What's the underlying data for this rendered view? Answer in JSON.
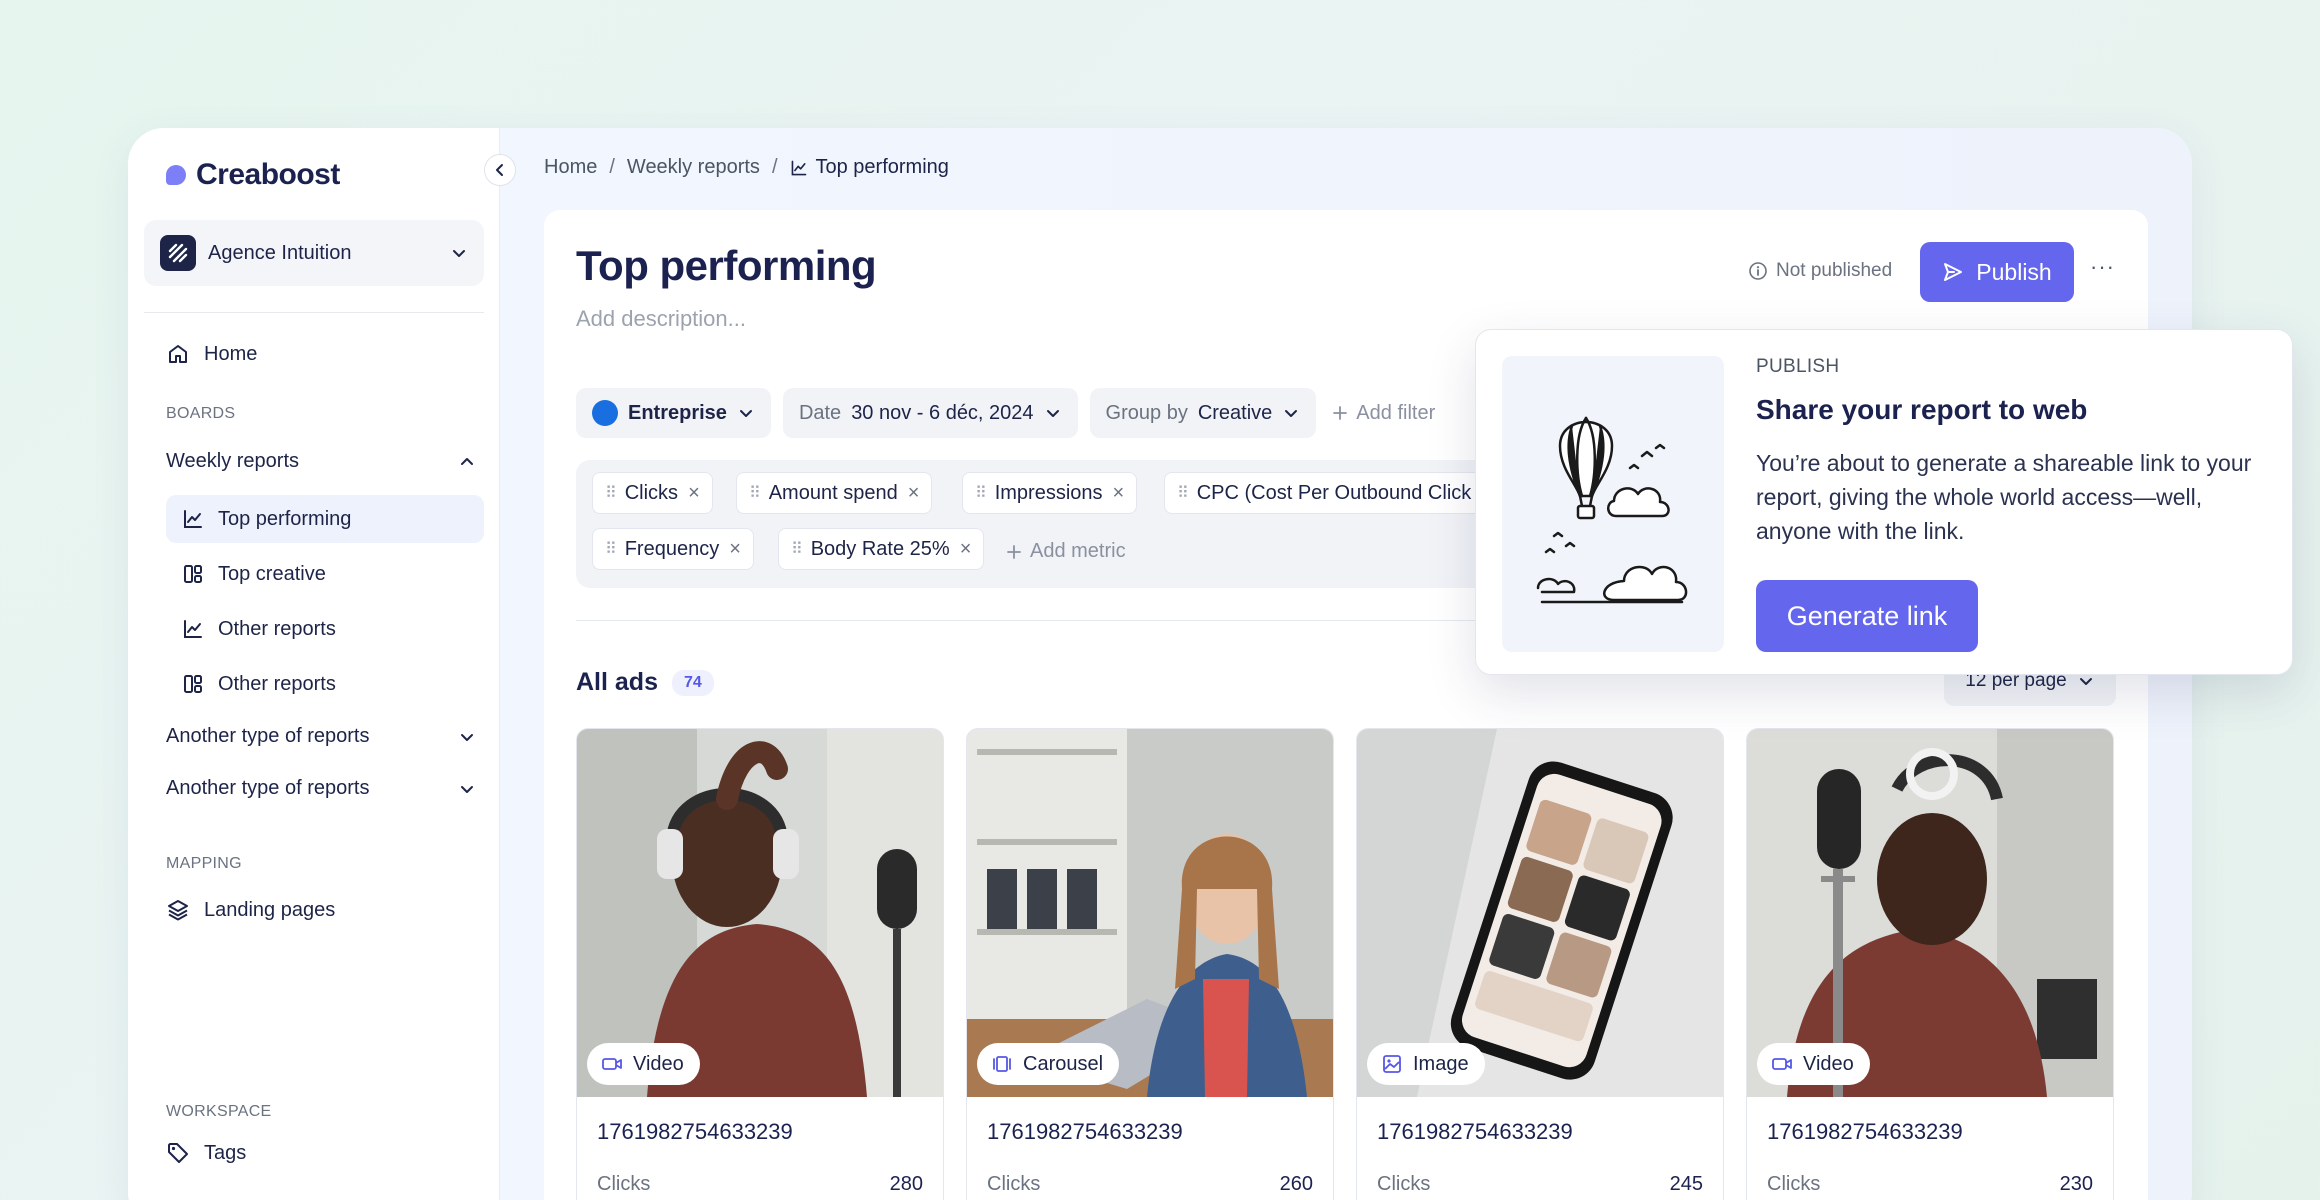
{
  "app": {
    "name": "Creaboost"
  },
  "workspace": {
    "name": "Agence Intuition"
  },
  "sidebar": {
    "home": "Home",
    "boards_label": "BOARDS",
    "weekly_reports": "Weekly reports",
    "sub_items": [
      "Top performing",
      "Top creative",
      "Other reports",
      "Other reports"
    ],
    "another_1": "Another type of reports",
    "another_2": "Another type of reports",
    "mapping_label": "MAPPING",
    "landing_pages": "Landing pages",
    "workspace_label": "WORKSPACE",
    "tags": "Tags"
  },
  "breadcrumb": {
    "home": "Home",
    "sep": "/",
    "weekly": "Weekly reports",
    "current": "Top performing"
  },
  "page": {
    "title": "Top performing",
    "description_placeholder": "Add description...",
    "status": "Not published",
    "publish": "Publish",
    "more": "···"
  },
  "filters": {
    "entreprise": "Entreprise",
    "date_label": "Date",
    "date_value": "30 nov - 6 déc, 2024",
    "group_label": "Group by",
    "group_value": "Creative",
    "add_filter": "Add filter"
  },
  "metrics": {
    "items": [
      "Clicks",
      "Amount spend",
      "Impressions",
      "CPC (Cost Per Outbound Click",
      "Frequency",
      "Body Rate 25%"
    ],
    "add_metric": "Add metric"
  },
  "ads": {
    "label": "All ads",
    "count": "74",
    "per_page": "12 per page",
    "cards": [
      {
        "type": "Video",
        "id": "1761982754633239",
        "metric": "Clicks",
        "value": "280"
      },
      {
        "type": "Carousel",
        "id": "1761982754633239",
        "metric": "Clicks",
        "value": "260"
      },
      {
        "type": "Image",
        "id": "1761982754633239",
        "metric": "Clicks",
        "value": "245"
      },
      {
        "type": "Video",
        "id": "1761982754633239",
        "metric": "Clicks",
        "value": "230"
      }
    ]
  },
  "popover": {
    "eyebrow": "PUBLISH",
    "title": "Share your report to web",
    "body": "You’re about to generate a shareable link to your report, giving the whole world access—well, anyone with the link.",
    "button": "Generate link"
  },
  "colors": {
    "accent": "#6466ee",
    "navy": "#1c2250",
    "active_bg": "#eef2fc"
  }
}
